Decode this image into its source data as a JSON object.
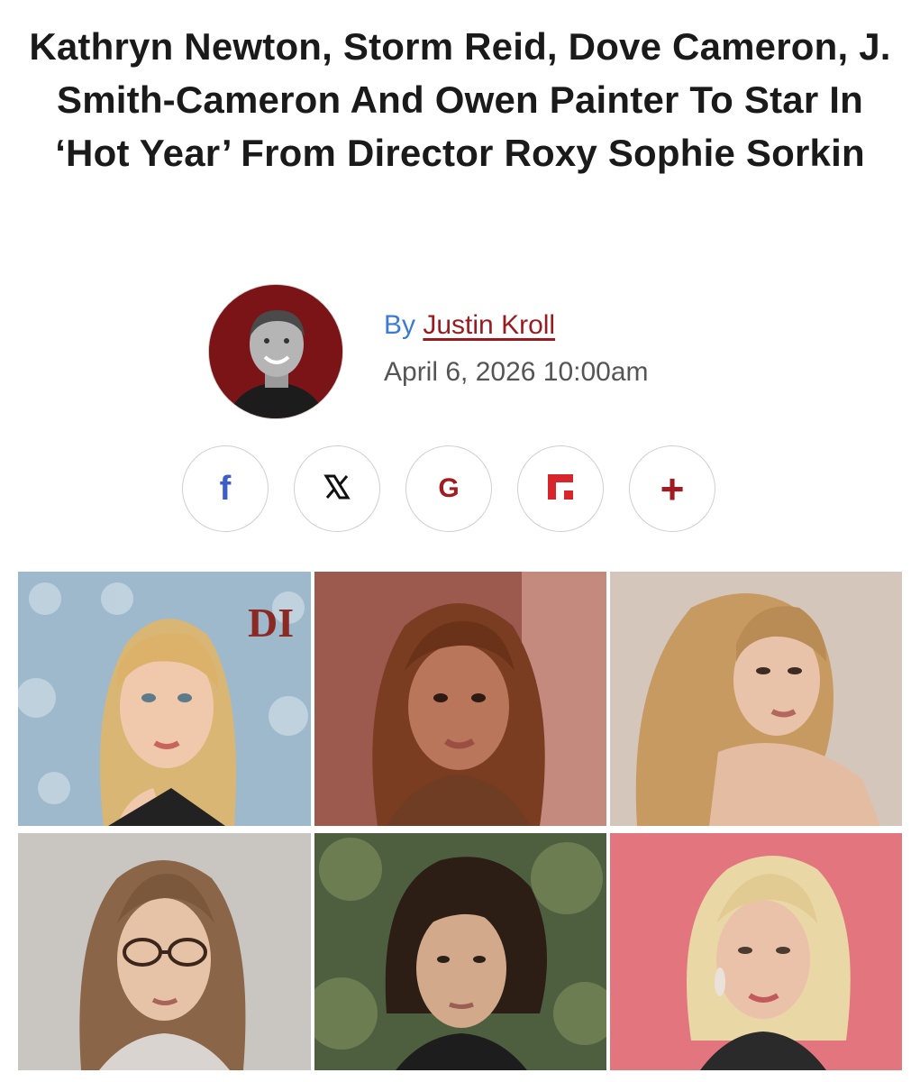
{
  "article": {
    "headline": "Kathryn Newton, Storm Reid, Dove Cameron, J. Smith-Cameron And Owen Painter To Star In ‘Hot Year’ From Director Roxy Sophie Sorkin",
    "byline_prefix": "By",
    "author": "Justin Kroll",
    "date": "April 6, 2026 10:00am"
  },
  "share": [
    {
      "icon": "facebook-icon",
      "glyph": "f",
      "color": "#3b5ec7"
    },
    {
      "icon": "x-icon",
      "glyph": "𝕏",
      "color": "#111111"
    },
    {
      "icon": "google-icon",
      "glyph": "G",
      "color": "#a01c20"
    },
    {
      "icon": "flipboard-icon",
      "glyph": "",
      "color": "#d6252b"
    },
    {
      "icon": "plus-icon",
      "glyph": "+",
      "color": "#a01c20"
    }
  ],
  "colors": {
    "brand_red": "#9a1b1f",
    "link_blue": "#3a7bd5",
    "headline": "#1a1a1a"
  }
}
